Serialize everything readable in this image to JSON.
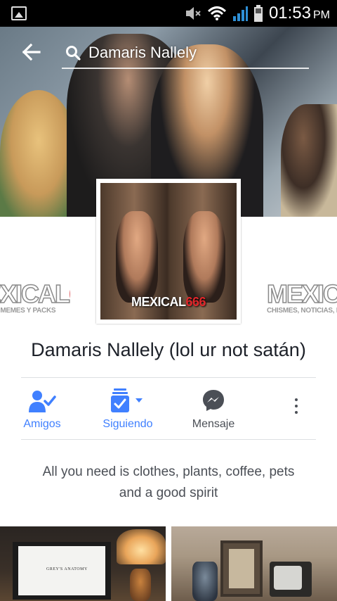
{
  "status_bar": {
    "time": "01:53",
    "ampm": "PM"
  },
  "header": {
    "search_text": "Damaris Nallely"
  },
  "profile": {
    "name": "Damaris Nallely (lol ur not satán)",
    "picture_logo_main": "MEXICAL",
    "picture_logo_num": "666"
  },
  "watermark": {
    "main": "MEXICAL",
    "num": "666",
    "left_sub": "NOTICIAS, MEMES Y PACKS",
    "right_sub": "CHISMES, NOTICIAS, MEMES"
  },
  "actions": {
    "friends_label": "Amigos",
    "following_label": "Siguiendo",
    "message_label": "Mensaje"
  },
  "bio": {
    "line1": "All you need is clothes, plants, coffee, pets",
    "line2": "and a good spirit"
  },
  "photos": {
    "photo1_caption": "GREY'S ANATOMY"
  },
  "colors": {
    "accent": "#4080ff",
    "action_text": "#4080ff",
    "message_icon": "#4b4f56",
    "watermark_red": "#d0181f"
  },
  "icons": {
    "back": "arrow-left-icon",
    "search": "search-icon",
    "friends": "person-check-icon",
    "following": "following-feed-icon",
    "message": "messenger-icon",
    "more": "more-vertical-icon"
  }
}
